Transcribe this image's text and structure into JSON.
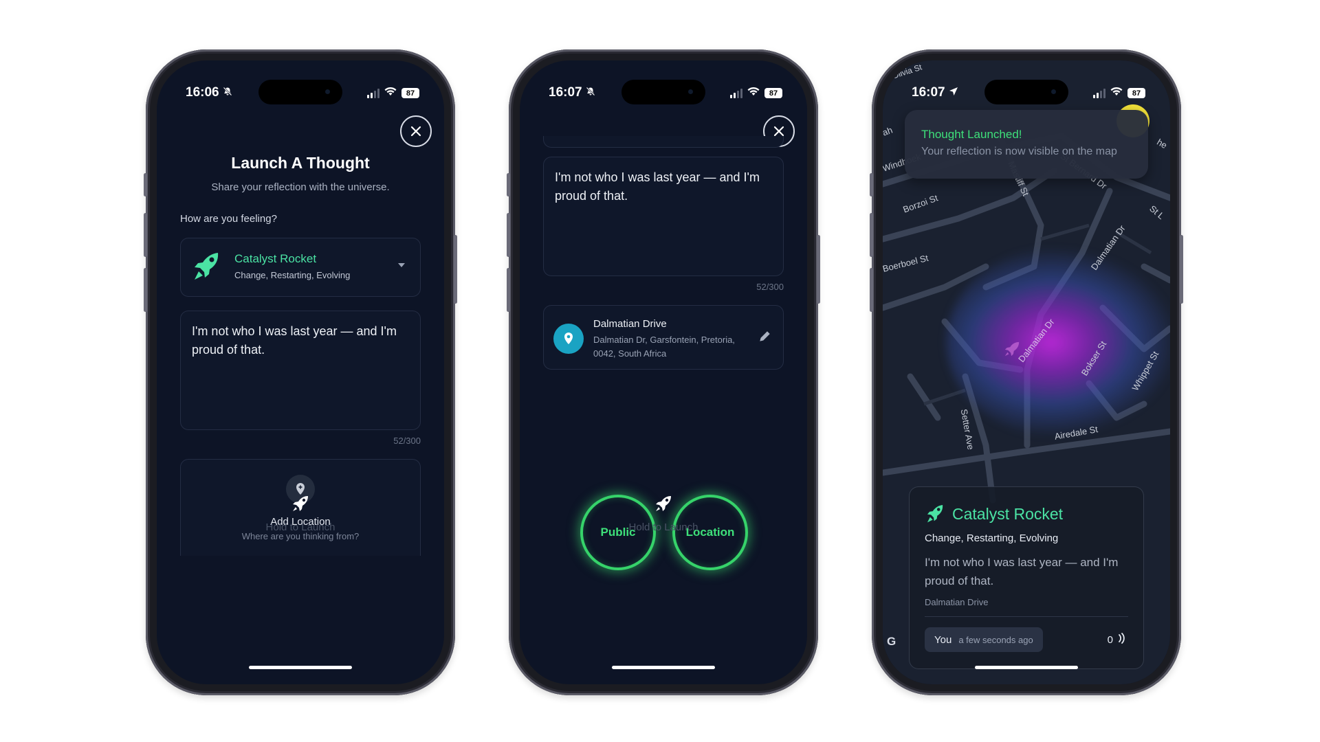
{
  "screen1": {
    "time": "16:06",
    "battery": "87",
    "title": "Launch A Thought",
    "subtitle": "Share your reflection with the universe.",
    "feeling_label": "How are you feeling?",
    "mood": {
      "name": "Catalyst Rocket",
      "tags": "Change, Restarting, Evolving",
      "icon": "rocket-icon"
    },
    "thought": "I'm not who I was last year — and I'm proud of that.",
    "counter": "52/300",
    "add_location": {
      "label": "Add Location",
      "sub": "Where are you thinking from?"
    },
    "launch_label": "Hold to Launch"
  },
  "screen2": {
    "time": "16:07",
    "battery": "87",
    "thought": "I'm not who I was last year — and I'm proud of that.",
    "counter": "52/300",
    "location": {
      "name": "Dalmatian Drive",
      "address": "Dalmatian Dr, Garsfontein, Pretoria, 0042, South Africa"
    },
    "public_btn": "Public",
    "location_btn": "Location",
    "launch_label": "Hold to Launch"
  },
  "screen3": {
    "time": "16:07",
    "battery": "87",
    "toast": {
      "title": "Thought Launched!",
      "message": "Your reflection is now visible on the map"
    },
    "streets": {
      "olivia": "Olivia St",
      "windhoek": "Windhoek",
      "borzoi": "Borzoi St",
      "boerboel": "Boerboel St",
      "mastiff": "Mastiff St",
      "bernard": "St Bernard Dr",
      "dalmatian1": "Dalmatian Dr",
      "dalmatian2": "Dalmatian Dr",
      "bokser": "Bokser St",
      "whippet": "Whippet St",
      "setter": "Setter Ave",
      "airedale": "Airedale St",
      "st_edge": "St L",
      "edge_left": "ah",
      "edge_right": "he"
    },
    "card": {
      "title": "Catalyst Rocket",
      "tags": "Change, Restarting, Evolving",
      "text": "I'm not who I was last year — and I'm proud of that.",
      "location": "Dalmatian Drive",
      "author": "You",
      "time_ago": "a few seconds ago",
      "count": "0"
    },
    "map_logo": "G"
  },
  "colors": {
    "background": "#0d1426",
    "mood_accent": "#4be3a4",
    "ring_green": "#36d36a",
    "location_pin": "#1aa3c3"
  }
}
